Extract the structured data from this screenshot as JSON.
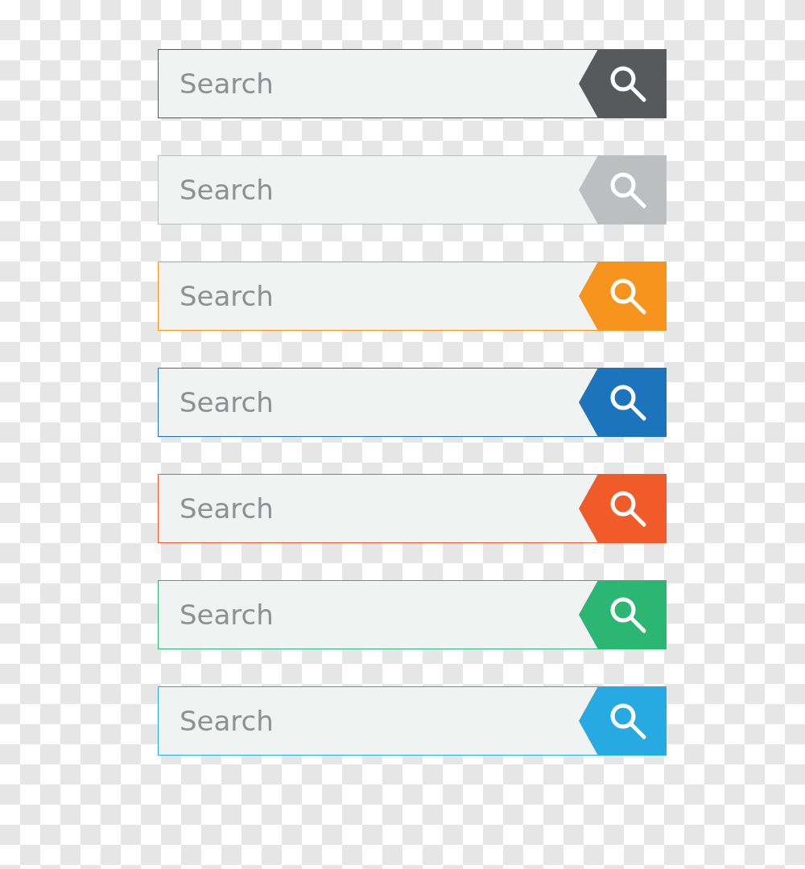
{
  "search_bars": [
    {
      "placeholder": "Search",
      "color": "#58595b"
    },
    {
      "placeholder": "Search",
      "color": "#bcbec0"
    },
    {
      "placeholder": "Search",
      "color": "#f7941d"
    },
    {
      "placeholder": "Search",
      "color": "#1c75bc"
    },
    {
      "placeholder": "Search",
      "color": "#f15a29"
    },
    {
      "placeholder": "Search",
      "color": "#2bb673"
    },
    {
      "placeholder": "Search",
      "color": "#27aae1"
    }
  ]
}
